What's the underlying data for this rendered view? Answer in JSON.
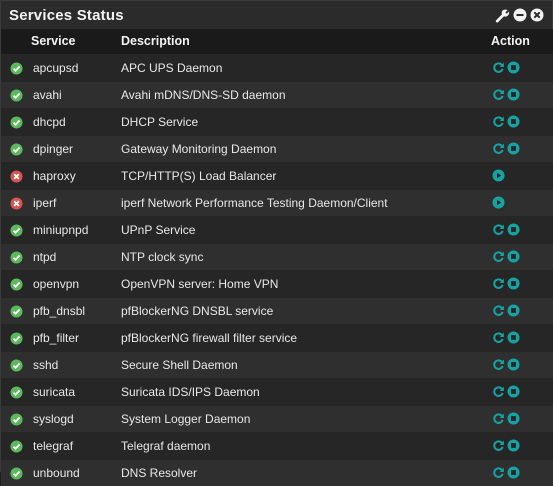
{
  "panel": {
    "title": "Services Status",
    "icons": [
      "wrench-icon",
      "minus-circle-icon",
      "close-circle-icon"
    ]
  },
  "columns": {
    "service": "Service",
    "description": "Description",
    "action": "Action"
  },
  "colors": {
    "running": "#5cb85c",
    "stopped": "#d9534f",
    "action": "#17a2a2"
  },
  "services": [
    {
      "name": "apcupsd",
      "description": "APC UPS Daemon",
      "status": "running"
    },
    {
      "name": "avahi",
      "description": "Avahi mDNS/DNS-SD daemon",
      "status": "running"
    },
    {
      "name": "dhcpd",
      "description": "DHCP Service",
      "status": "running"
    },
    {
      "name": "dpinger",
      "description": "Gateway Monitoring Daemon",
      "status": "running"
    },
    {
      "name": "haproxy",
      "description": "TCP/HTTP(S) Load Balancer",
      "status": "stopped"
    },
    {
      "name": "iperf",
      "description": "iperf Network Performance Testing Daemon/Client",
      "status": "stopped"
    },
    {
      "name": "miniupnpd",
      "description": "UPnP Service",
      "status": "running"
    },
    {
      "name": "ntpd",
      "description": "NTP clock sync",
      "status": "running"
    },
    {
      "name": "openvpn",
      "description": "OpenVPN server: Home VPN",
      "status": "running"
    },
    {
      "name": "pfb_dnsbl",
      "description": "pfBlockerNG DNSBL service",
      "status": "running"
    },
    {
      "name": "pfb_filter",
      "description": "pfBlockerNG firewall filter service",
      "status": "running"
    },
    {
      "name": "sshd",
      "description": "Secure Shell Daemon",
      "status": "running"
    },
    {
      "name": "suricata",
      "description": "Suricata IDS/IPS Daemon",
      "status": "running"
    },
    {
      "name": "syslogd",
      "description": "System Logger Daemon",
      "status": "running"
    },
    {
      "name": "telegraf",
      "description": "Telegraf daemon",
      "status": "running"
    },
    {
      "name": "unbound",
      "description": "DNS Resolver",
      "status": "running"
    }
  ]
}
